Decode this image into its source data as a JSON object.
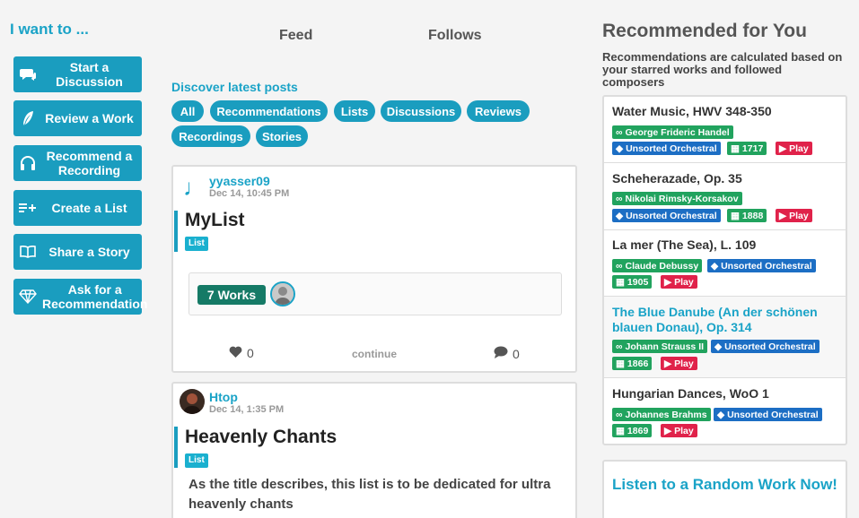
{
  "sidebar": {
    "heading": "I want to ...",
    "actions": [
      {
        "label": "Start a Discussion",
        "icon": "chat-icon"
      },
      {
        "label": "Review a Work",
        "icon": "feather-icon"
      },
      {
        "label": "Recommend a Recording",
        "icon": "headphones-icon"
      },
      {
        "label": "Create a List",
        "icon": "list-add-icon"
      },
      {
        "label": "Share a Story",
        "icon": "book-icon"
      },
      {
        "label": "Ask for a Recommendation",
        "icon": "diamond-icon"
      }
    ]
  },
  "feed": {
    "tabs": [
      "Feed",
      "Follows"
    ],
    "discover": "Discover latest posts",
    "filters": [
      "All",
      "Recommendations",
      "Lists",
      "Discussions",
      "Reviews",
      "Recordings",
      "Stories"
    ],
    "posts": [
      {
        "user": "yyasser09",
        "date": "Dec 14, 10:45 PM",
        "title": "MyList",
        "tag": "List",
        "works": "7 Works",
        "likes": "0",
        "continue": "continue",
        "comments": "0"
      },
      {
        "user": "Htop",
        "date": "Dec 14, 1:35 PM",
        "title": "Heavenly Chants",
        "tag": "List",
        "description": "As the title describes, this list is to be dedicated for ultra heavenly chants"
      }
    ]
  },
  "recommended": {
    "heading": "Recommended for You",
    "subtitle": "Recommendations are calculated based on your starred works and followed composers",
    "items": [
      {
        "title": "Water Music, HWV 348-350",
        "composer": "George Frideric Handel",
        "genre": "Unsorted Orchestral",
        "year": "1717",
        "play": "Play"
      },
      {
        "title": "Scheherazade, Op. 35",
        "composer": "Nikolai Rimsky-Korsakov",
        "genre": "Unsorted Orchestral",
        "year": "1888",
        "play": "Play"
      },
      {
        "title": "La mer (The Sea), L. 109",
        "composer": "Claude Debussy",
        "genre": "Unsorted Orchestral",
        "year": "1905",
        "play": "Play"
      },
      {
        "title": "The Blue Danube (An der schönen blauen Donau), Op. 314",
        "composer": "Johann Strauss II",
        "genre": "Unsorted Orchestral",
        "year": "1866",
        "play": "Play"
      },
      {
        "title": "Hungarian Dances, WoO 1",
        "composer": "Johannes Brahms",
        "genre": "Unsorted Orchestral",
        "year": "1869",
        "play": "Play"
      }
    ],
    "listen": "Listen to a Random Work Now!"
  },
  "colors": {
    "accent": "#1a9dbf",
    "green": "#21a35e",
    "blue": "#1c6ec4",
    "red": "#e0224a",
    "works": "#157a66"
  }
}
